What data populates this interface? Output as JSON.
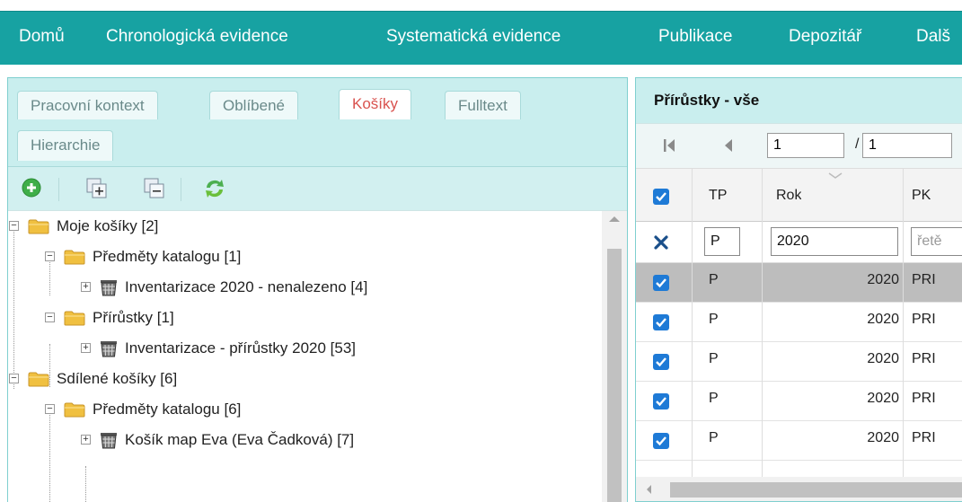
{
  "nav": {
    "items": [
      "Domů",
      "Chronologická evidence",
      "Systematická evidence",
      "Publikace",
      "Depozitář",
      "Dalš"
    ]
  },
  "left": {
    "tabs": [
      "Pracovní kontext",
      "Oblíbené",
      "Košíky",
      "Fulltext",
      "Hierarchie"
    ],
    "active_tab": "Košíky",
    "toolbar_icons": [
      "add-icon",
      "expand-all-icon",
      "collapse-all-icon",
      "refresh-icon"
    ],
    "tree": [
      {
        "label": "Moje košíky [2]",
        "type": "folder"
      },
      {
        "label": "Předměty katalogu [1]",
        "type": "folder"
      },
      {
        "label": "Inventarizace 2020 - nenalezeno [4]",
        "type": "basket"
      },
      {
        "label": "Přírůstky [1]",
        "type": "folder"
      },
      {
        "label": "Inventarizace - přírůstky 2020 [53]",
        "type": "basket"
      },
      {
        "label": "Sdílené košíky [6]",
        "type": "folder"
      },
      {
        "label": "Předměty katalogu [6]",
        "type": "folder"
      },
      {
        "label": "Košík map Eva (Eva Čadková) [7]",
        "type": "basket"
      }
    ]
  },
  "right": {
    "title": "Přírůstky - vše",
    "pager": {
      "page": "1",
      "total": "1",
      "slash": "/"
    },
    "columns": {
      "tp": "TP",
      "rok": "Rok",
      "pk": "PK"
    },
    "filters": {
      "tp": "P",
      "rok": "2020",
      "pk_placeholder": "řetě"
    },
    "rows": [
      {
        "tp": "P",
        "rok": "2020",
        "pk": "PRI",
        "selected": true
      },
      {
        "tp": "P",
        "rok": "2020",
        "pk": "PRI",
        "selected": false
      },
      {
        "tp": "P",
        "rok": "2020",
        "pk": "PRI",
        "selected": false
      },
      {
        "tp": "P",
        "rok": "2020",
        "pk": "PRI",
        "selected": false
      },
      {
        "tp": "P",
        "rok": "2020",
        "pk": "PRI",
        "selected": false
      }
    ]
  },
  "colors": {
    "nav_bg": "#17a2a2",
    "tab_active": "#d9534f",
    "panel_header": "#c9eeee",
    "checkbox": "#1e7ad6"
  }
}
